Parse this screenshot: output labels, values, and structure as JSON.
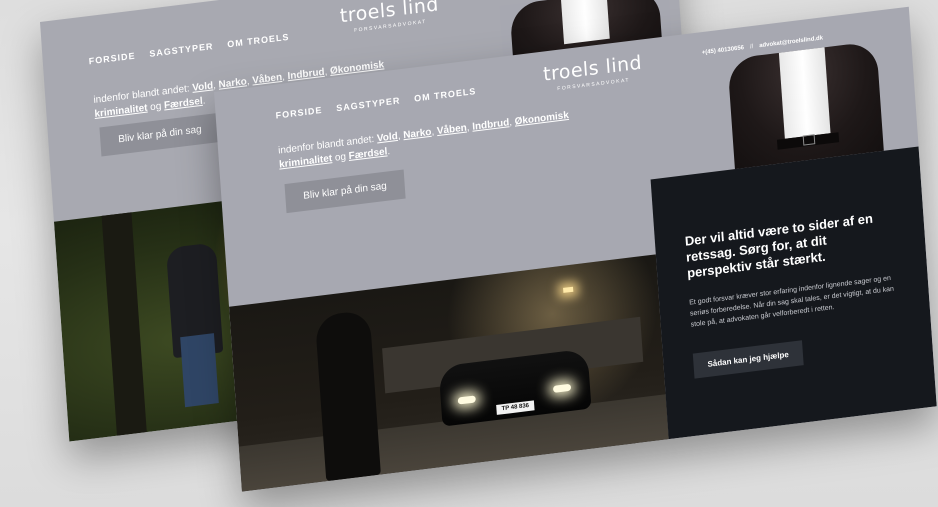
{
  "site": {
    "nav": [
      "FORSIDE",
      "SAGSTYPER",
      "OM TROELS"
    ],
    "logo": {
      "name": "troels lind",
      "subtitle": "FORSVARSADVOKAT"
    },
    "contact": {
      "phone": "+(45) 40130656",
      "separator": "//",
      "email": "advokat@troelslind.dk"
    },
    "intro": {
      "prefix": "indenfor blandt andet: ",
      "areas": [
        "Vold",
        "Narko",
        "Våben",
        "Indbrud",
        "Økonomisk kriminalitet"
      ],
      "joiner": "og",
      "last": "Færdsel",
      "suffix": "."
    },
    "cta_label": "Bliv klar på din sag"
  },
  "panel": {
    "headline": "Der vil altid være to sider af en retssag. Sørg for, at dit perspektiv står stærkt.",
    "body": "Et godt forsvar kræver stor erfaring indenfor lignende sager og en seriøs forberedelse. Når din sag skal tales, er det vigtigt, at du kan stole på, at advokaten går velforberedt i retten.",
    "button_label": "Sådan kan jeg hjælpe"
  },
  "photo": {
    "plate": "TP 48 836"
  },
  "colors": {
    "header_bg": "#a7a8b1",
    "panel_bg": "#15181d",
    "button_bg": "#8f9098"
  }
}
